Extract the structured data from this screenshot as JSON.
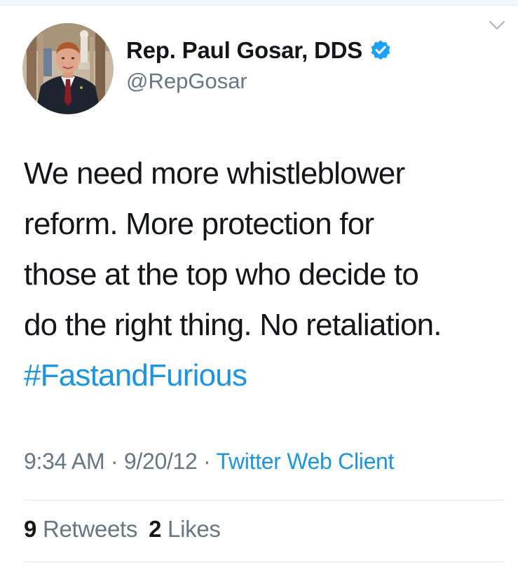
{
  "tweet": {
    "author": {
      "display_name": "Rep. Paul Gosar, DDS",
      "handle": "@RepGosar",
      "verified": true
    },
    "text_lines": [
      "We need more whistleblower",
      "reform. More protection for",
      "those at the top who decide to",
      "do the right thing. No retaliation."
    ],
    "hashtag": "#FastandFurious",
    "time": "9:34 AM",
    "date": "9/20/12",
    "separator": "·",
    "source": "Twitter Web Client",
    "stats": {
      "retweets_count": "9",
      "retweets_label": "Retweets",
      "likes_count": "2",
      "likes_label": "Likes"
    }
  },
  "icons": {
    "menu": "chevron-down-icon",
    "verified": "verified-badge-icon"
  },
  "colors": {
    "link": "#1b95e0",
    "text": "#14171a",
    "muted": "#657786",
    "divider": "#e1e8ed",
    "verified": "#1da1f2"
  }
}
